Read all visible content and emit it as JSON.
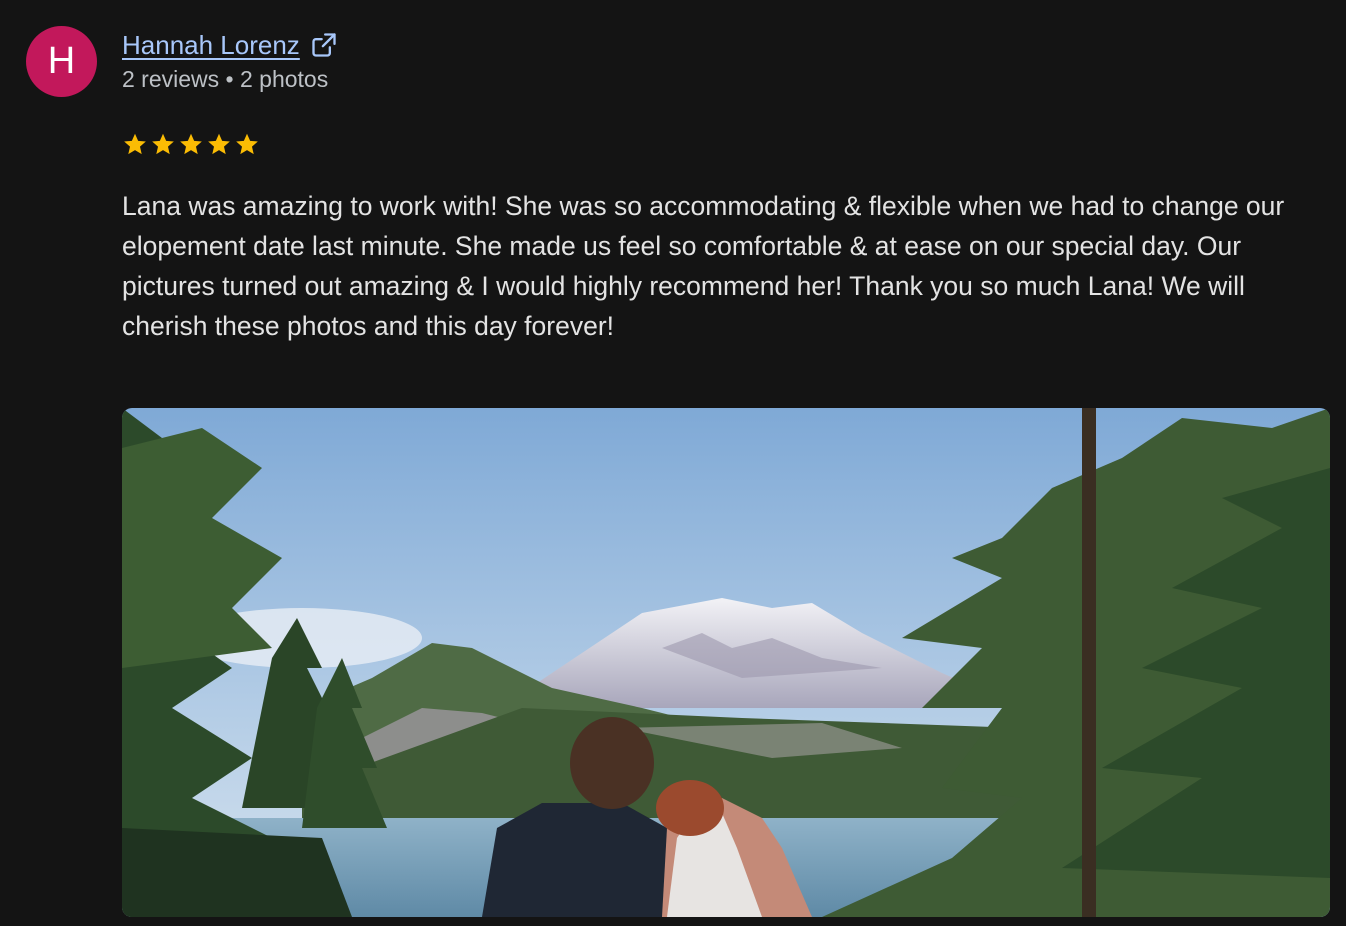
{
  "reviewer": {
    "initial": "H",
    "avatar_color": "#c2185b",
    "name": "Hannah Lorenz",
    "stats": "2 reviews • 2 photos",
    "link_icon": "open-in-new-icon"
  },
  "rating": {
    "stars": 5,
    "max": 5,
    "star_color": "#fbbc04"
  },
  "review_text": "Lana was amazing to work with! She was so accommodating & flexible when we had to change our elopement date last minute. She made us feel so comfortable & at ease on our special day. Our pictures turned out amazing & I would highly recommend her! Thank you so much Lana! We will cherish these photos and this day forever!",
  "colors": {
    "background": "#141414",
    "link": "#a8c7fa",
    "text": "#e3e3e3",
    "secondary_text": "#bdc1c6"
  }
}
